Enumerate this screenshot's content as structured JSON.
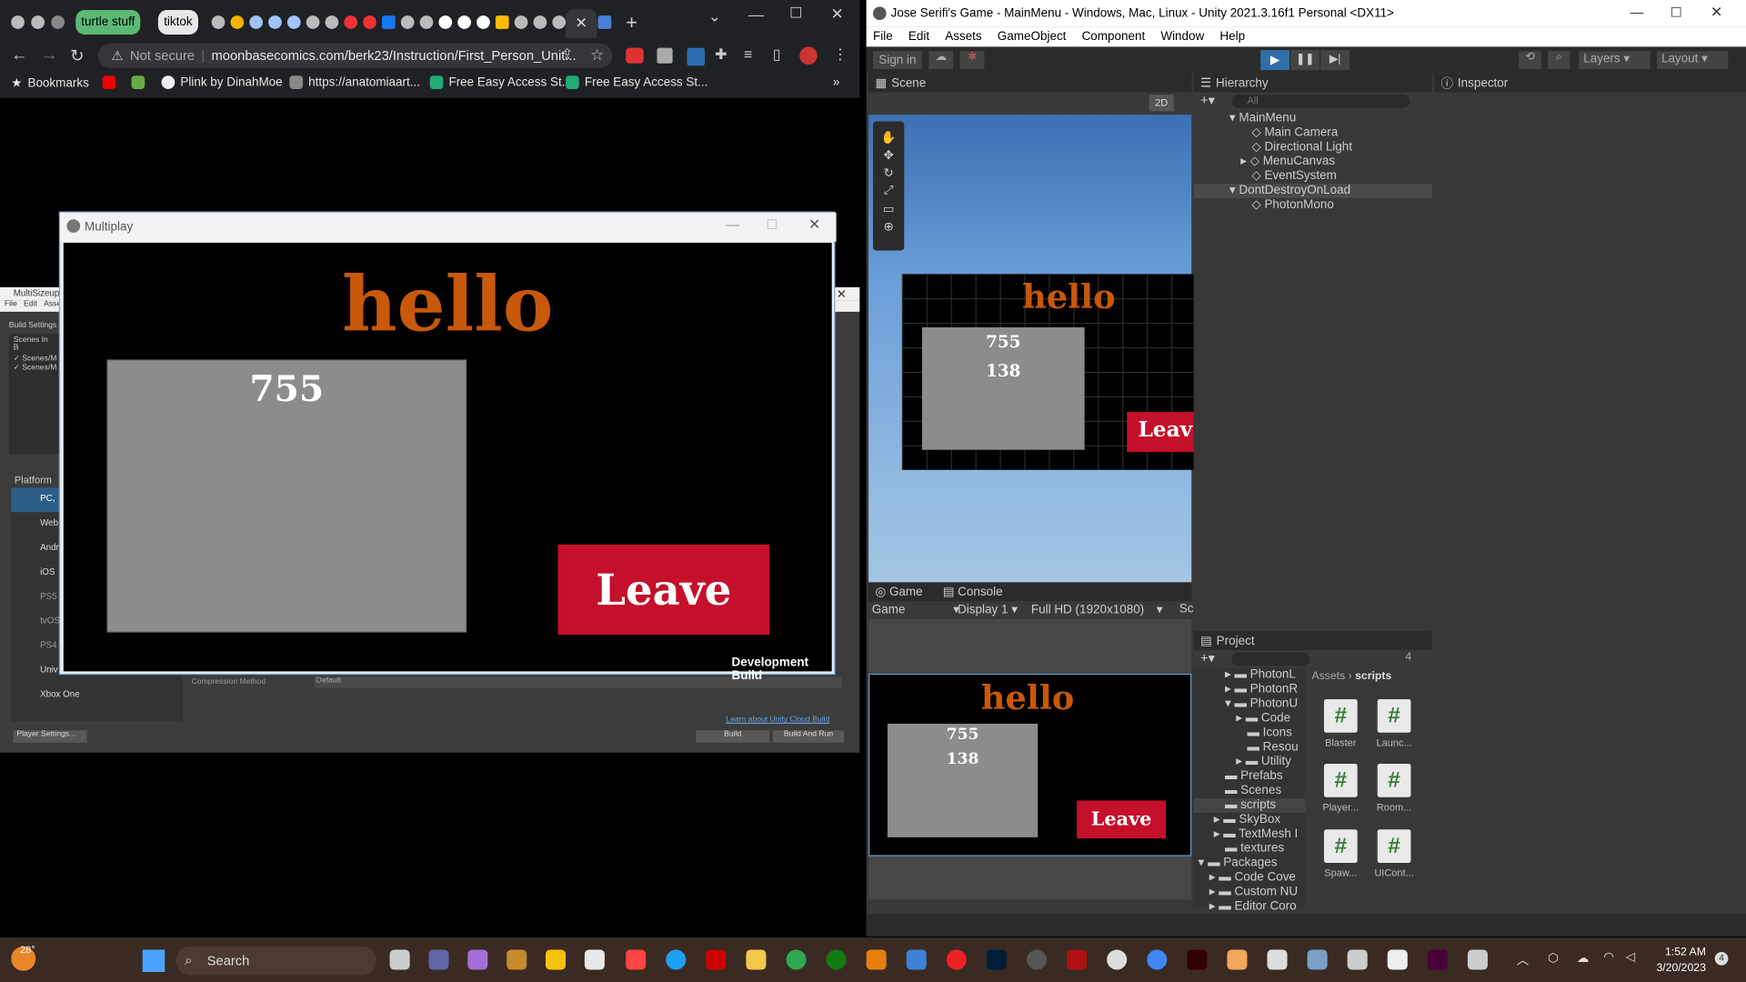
{
  "browser": {
    "tabs": [
      {
        "label": "turtle stuff",
        "color": "#5bb974"
      },
      {
        "label": "tiktok",
        "color": "#e8e8e8"
      }
    ],
    "security": "Not secure",
    "url": "moonbasecomics.com/berk23/Instruction/First_Person_Unit...",
    "bookmarks": [
      "Bookmarks",
      "Plink by DinahMoe",
      "https://anatomiaart...",
      "Free Easy Access St...",
      "Free Easy Access St..."
    ]
  },
  "multiplay": {
    "title": "Multiplay",
    "hello": "hello",
    "score": "755",
    "leave": "Leave",
    "dev_build": "Development Build"
  },
  "build_settings": {
    "title": "MultiSizeup",
    "menu": [
      "File",
      "Edit",
      "Asse"
    ],
    "header": "Build Settings",
    "scenes_label": "Scenes In B",
    "scenes": [
      "Scenes/M",
      "Scenes/M"
    ],
    "platform_label": "Platform",
    "platforms": [
      "PC,",
      "Web",
      "Andr",
      "iOS",
      "PS5",
      "tvOS",
      "PS4",
      "Univ",
      "Xbox One"
    ],
    "compression_label": "Compression Method",
    "compression_value": "Default",
    "cloud_link": "Learn about Unity Cloud Build",
    "player_settings": "Player Settings...",
    "build": "Build",
    "build_and_run": "Build And Run"
  },
  "unity": {
    "title": "Jose Serifi's Game - MainMenu - Windows, Mac, Linux - Unity 2021.3.16f1 Personal <DX11>",
    "menu": [
      "File",
      "Edit",
      "Assets",
      "GameObject",
      "Component",
      "Window",
      "Help"
    ],
    "sign_in": "Sign in",
    "layers": "Layers",
    "layout": "Layout",
    "scene_tab": "Scene",
    "mode_2d": "2D",
    "scene_hello": "hello",
    "scene_score1": "755",
    "scene_score2": "138",
    "scene_leave": "Leav",
    "hierarchy_tab": "Hierarchy",
    "hierarchy_search": "All",
    "hierarchy": [
      {
        "label": "MainMenu",
        "indent": 0,
        "scene": true
      },
      {
        "label": "Main Camera",
        "indent": 2
      },
      {
        "label": "Directional Light",
        "indent": 2
      },
      {
        "label": "MenuCanvas",
        "indent": 2
      },
      {
        "label": "EventSystem",
        "indent": 2
      },
      {
        "label": "DontDestroyOnLoad",
        "indent": 0,
        "scene": true
      },
      {
        "label": "PhotonMono",
        "indent": 2
      }
    ],
    "inspector_tab": "Inspector",
    "game_tab": "Game",
    "console_tab": "Console",
    "game_dropdown": "Game",
    "display": "Display 1",
    "resolution": "Full HD (1920x1080)",
    "scale": "Sc",
    "game_hello": "hello",
    "game_score1": "755",
    "game_score2": "138",
    "game_leave": "Leave",
    "project_tab": "Project",
    "project_count": "4",
    "breadcrumb": [
      "Assets",
      "scripts"
    ],
    "folders": [
      "PhotonL",
      "PhotonR",
      "PhotonU",
      "Code",
      "Icons",
      "Resou",
      "Utility",
      "Prefabs",
      "Scenes",
      "scripts",
      "SkyBox",
      "TextMesh I",
      "textures",
      "Packages",
      "Code Cove",
      "Custom NU",
      "Editor Coro"
    ],
    "assets": [
      "Blaster",
      "Launc...",
      "Player...",
      "Room...",
      "Spaw...",
      "UICont..."
    ]
  },
  "taskbar": {
    "weather": "28°",
    "search": "Search",
    "time": "1:52 AM",
    "date": "3/20/2023",
    "notif": "4"
  }
}
